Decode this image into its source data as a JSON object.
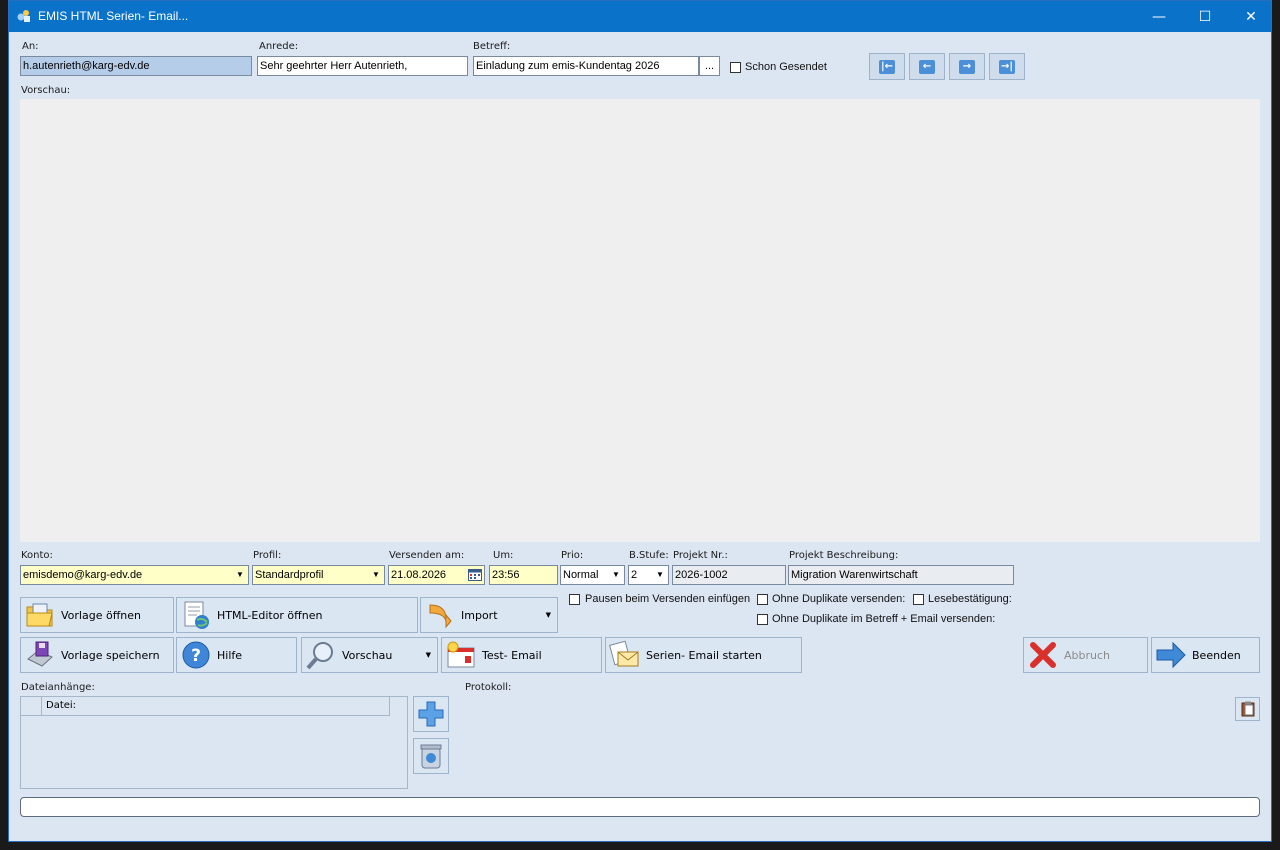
{
  "window": {
    "title": "EMIS HTML Serien- Email...",
    "minimize": "—",
    "maximize": "☐",
    "close": "✕"
  },
  "header": {
    "an_label": "An:",
    "an_value": "h.autenrieth@karg-edv.de",
    "anrede_label": "Anrede:",
    "anrede_value": "Sehr geehrter Herr Autenrieth,",
    "betreff_label": "Betreff:",
    "betreff_value": "Einladung zum emis-Kundentag 2026",
    "betreff_btn": "...",
    "schon_gesendet": "Schon Gesendet",
    "nav": [
      "first-record-icon",
      "prev-record-icon",
      "next-record-icon",
      "last-record-icon"
    ],
    "nav_glyphs": [
      "|←",
      "←",
      "→",
      "→|"
    ]
  },
  "preview": {
    "label": "Vorschau:"
  },
  "settings": {
    "konto_label": "Konto:",
    "konto_value": "emisdemo@karg-edv.de",
    "profil_label": "Profil:",
    "profil_value": "Standardprofil",
    "versenden_label": "Versenden am:",
    "versenden_value": "21.08.2026",
    "um_label": "Um:",
    "um_value": "23:56",
    "prio_label": "Prio:",
    "prio_value": "Normal",
    "bstufe_label": "B.Stufe:",
    "bstufe_value": "2",
    "projekt_nr_label": "Projekt Nr.:",
    "projekt_nr_value": "2026-1002",
    "projekt_beschr_label": "Projekt Beschreibung:",
    "projekt_beschr_value": "Migration Warenwirtschaft"
  },
  "options": {
    "pausen": "Pausen beim Versenden einfügen",
    "ohne_duplikate": "Ohne Duplikate versenden:",
    "lesebestaetigung": "Lesebestätigung:",
    "ohne_duplikate_betreff": "Ohne Duplikate im Betreff + Email versenden:"
  },
  "buttons": {
    "vorlage_oeffnen": "Vorlage öffnen",
    "html_editor": "HTML-Editor öffnen",
    "import": "Import",
    "vorlage_speichern": "Vorlage speichern",
    "hilfe": "Hilfe",
    "vorschau": "Vorschau",
    "test_email": "Test- Email",
    "serien_start": "Serien- Email starten",
    "abbruch": "Abbruch",
    "beenden": "Beenden"
  },
  "attachments": {
    "label": "Dateianhänge:",
    "col_datei": "Datei:"
  },
  "protokoll": {
    "label": "Protokoll:"
  },
  "colors": {
    "titlebar": "#0b72c9",
    "window_bg": "#dce6f2",
    "yellow_field": "#ffffc8",
    "accent_red": "#d9302c",
    "accent_blue": "#3e8ad6"
  }
}
